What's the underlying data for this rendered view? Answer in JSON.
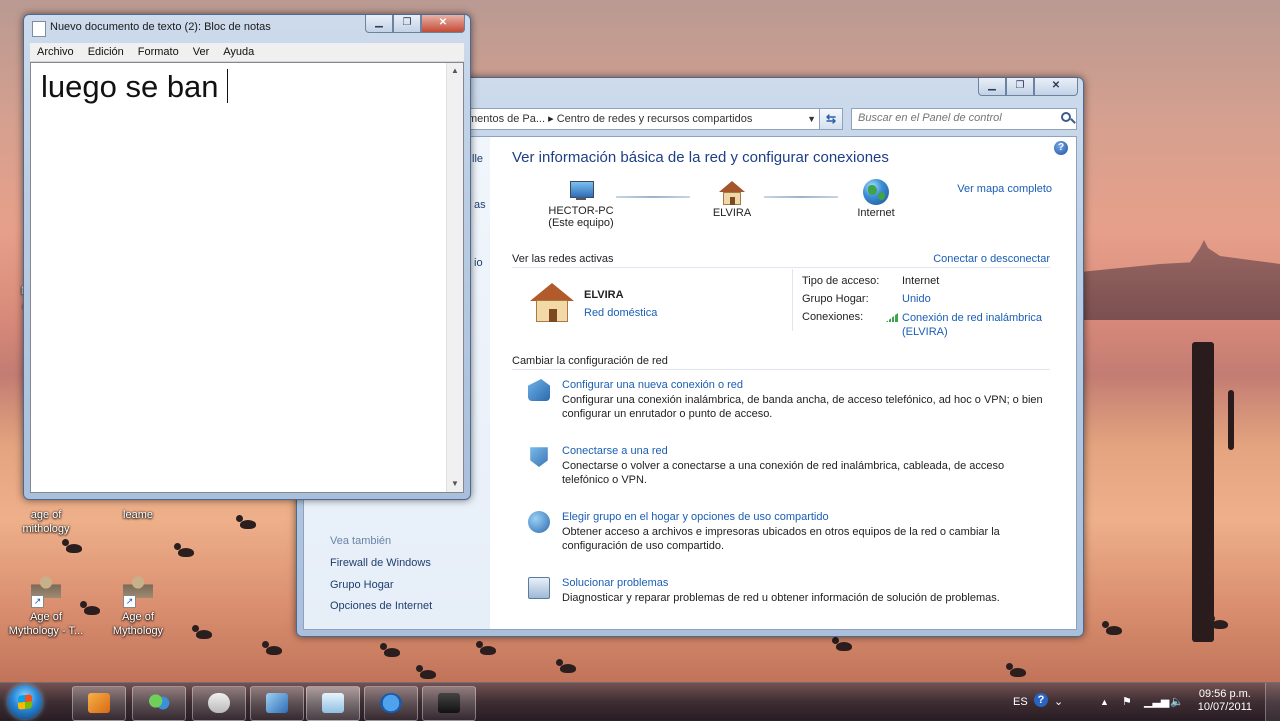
{
  "desktop": {
    "icons": [
      {
        "label": "age of mithology",
        "kind": "plain"
      },
      {
        "label": "leame",
        "kind": "plain"
      },
      {
        "label": "Age of Mythology - T...",
        "kind": "warrior"
      },
      {
        "label": "Age of Mythology",
        "kind": "warrior"
      }
    ],
    "edge_label_top": "M",
    "edge_label_bottom": "A"
  },
  "control_panel": {
    "address_segments": [
      "mentos de Pa...",
      "Centro de redes y recursos compartidos"
    ],
    "search_placeholder": "Buscar en el Panel de control",
    "heading": "Ver información básica de la red y configurar conexiones",
    "full_map_link": "Ver mapa completo",
    "map_nodes": [
      {
        "name": "HECTOR-PC",
        "sub": "(Este equipo)",
        "icon": "computer-icon"
      },
      {
        "name": "ELVIRA",
        "sub": "",
        "icon": "house-icon"
      },
      {
        "name": "Internet",
        "sub": "",
        "icon": "globe-icon"
      }
    ],
    "active_networks_label": "Ver las redes activas",
    "connect_link": "Conectar o desconectar",
    "network": {
      "name": "ELVIRA",
      "type_link": "Red doméstica",
      "access_type_label": "Tipo de acceso:",
      "access_type_value": "Internet",
      "homegroup_label": "Grupo Hogar:",
      "homegroup_value": "Unido",
      "connections_label": "Conexiones:",
      "connection_link": "Conexión de red inalámbrica (ELVIRA)"
    },
    "change_settings_label": "Cambiar la configuración de red",
    "tasks": [
      {
        "title": "Configurar una nueva conexión o red",
        "desc": "Configurar una conexión inalámbrica, de banda ancha, de acceso telefónico, ad hoc o VPN; o bien configurar un enrutador o punto de acceso."
      },
      {
        "title": "Conectarse a una red",
        "desc": "Conectarse o volver a conectarse a una conexión de red inalámbrica, cableada, de acceso telefónico o VPN."
      },
      {
        "title": "Elegir grupo en el hogar y opciones de uso compartido",
        "desc": "Obtener acceso a archivos e impresoras ubicados en otros equipos de la red o cambiar la configuración de uso compartido."
      },
      {
        "title": "Solucionar problemas",
        "desc": "Diagnosticar y reparar problemas de red u obtener información de solución de problemas."
      }
    ],
    "left_pane": {
      "see_also": "Vea también",
      "links": [
        "Firewall de Windows",
        "Grupo Hogar",
        "Opciones de Internet"
      ],
      "partial_labels": [
        "lle",
        "as",
        "io"
      ]
    }
  },
  "notepad": {
    "title": "Nuevo documento de texto (2): Bloc de notas",
    "menu": [
      "Archivo",
      "Edición",
      "Formato",
      "Ver",
      "Ayuda"
    ],
    "content": "luego se ban"
  },
  "taskbar": {
    "language": "ES",
    "time": "09:56 p.m.",
    "date": "10/07/2011"
  }
}
